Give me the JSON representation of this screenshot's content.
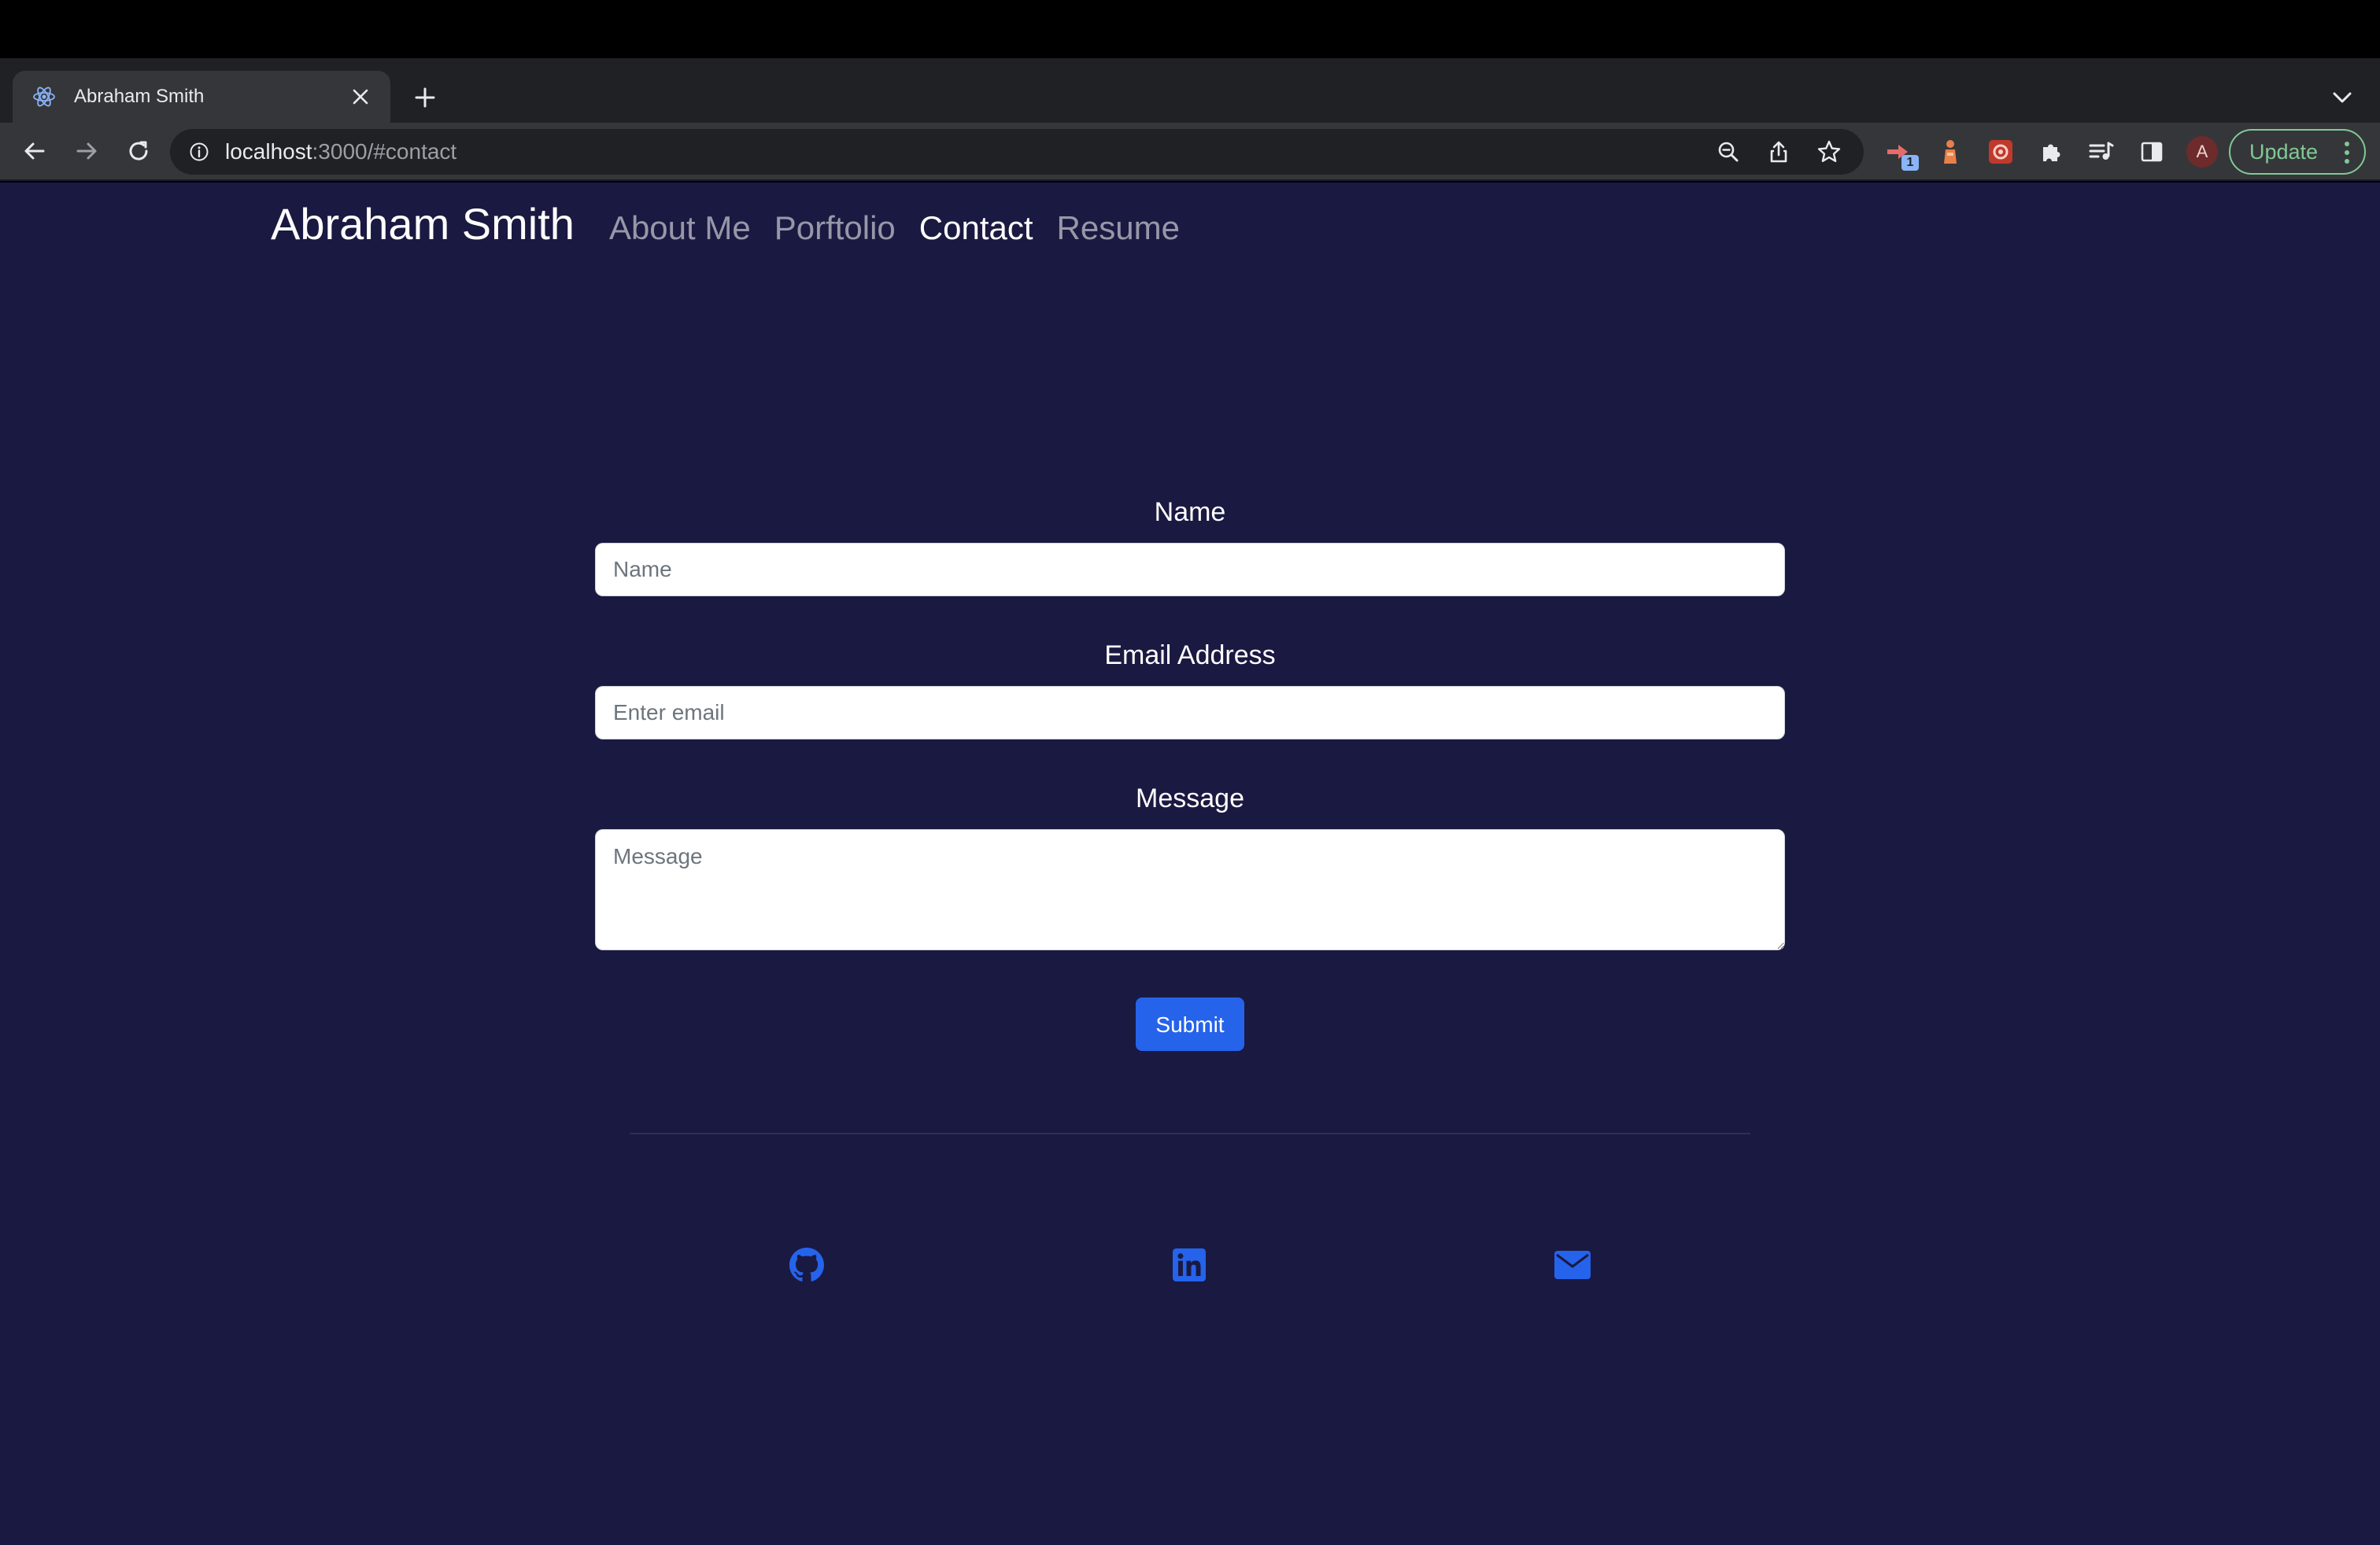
{
  "browser": {
    "tab": {
      "title": "Abraham Smith",
      "favicon": "react-icon"
    },
    "url": {
      "host": "localhost",
      "rest": ":3000/#contact"
    },
    "update_label": "Update",
    "extension_badge": "1",
    "profile_initial": "A"
  },
  "page": {
    "brand": "Abraham Smith",
    "nav": [
      {
        "label": "About Me",
        "active": false
      },
      {
        "label": "Porftolio",
        "active": false
      },
      {
        "label": "Contact",
        "active": true
      },
      {
        "label": "Resume",
        "active": false
      }
    ],
    "form": {
      "name_label": "Name",
      "name_placeholder": "Name",
      "email_label": "Email Address",
      "email_placeholder": "Enter email",
      "message_label": "Message",
      "message_placeholder": "Message",
      "submit_label": "Submit"
    },
    "socials": [
      "github-icon",
      "linkedin-icon",
      "envelope-icon"
    ]
  },
  "colors": {
    "page_bg": "#1a1941",
    "accent": "#2563eb",
    "update_green": "#81c995"
  }
}
